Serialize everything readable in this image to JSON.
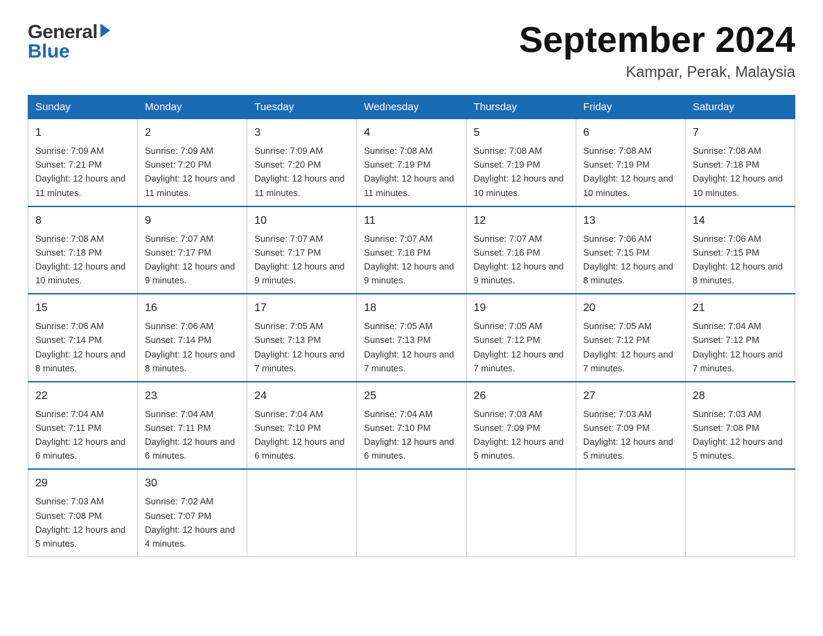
{
  "header": {
    "logo_general": "General",
    "logo_blue": "Blue",
    "month_title": "September 2024",
    "location": "Kampar, Perak, Malaysia"
  },
  "days_of_week": [
    "Sunday",
    "Monday",
    "Tuesday",
    "Wednesday",
    "Thursday",
    "Friday",
    "Saturday"
  ],
  "weeks": [
    [
      {
        "day": "1",
        "sunrise": "7:09 AM",
        "sunset": "7:21 PM",
        "daylight": "12 hours and 11 minutes."
      },
      {
        "day": "2",
        "sunrise": "7:09 AM",
        "sunset": "7:20 PM",
        "daylight": "12 hours and 11 minutes."
      },
      {
        "day": "3",
        "sunrise": "7:09 AM",
        "sunset": "7:20 PM",
        "daylight": "12 hours and 11 minutes."
      },
      {
        "day": "4",
        "sunrise": "7:08 AM",
        "sunset": "7:19 PM",
        "daylight": "12 hours and 11 minutes."
      },
      {
        "day": "5",
        "sunrise": "7:08 AM",
        "sunset": "7:19 PM",
        "daylight": "12 hours and 10 minutes."
      },
      {
        "day": "6",
        "sunrise": "7:08 AM",
        "sunset": "7:19 PM",
        "daylight": "12 hours and 10 minutes."
      },
      {
        "day": "7",
        "sunrise": "7:08 AM",
        "sunset": "7:18 PM",
        "daylight": "12 hours and 10 minutes."
      }
    ],
    [
      {
        "day": "8",
        "sunrise": "7:08 AM",
        "sunset": "7:18 PM",
        "daylight": "12 hours and 10 minutes."
      },
      {
        "day": "9",
        "sunrise": "7:07 AM",
        "sunset": "7:17 PM",
        "daylight": "12 hours and 9 minutes."
      },
      {
        "day": "10",
        "sunrise": "7:07 AM",
        "sunset": "7:17 PM",
        "daylight": "12 hours and 9 minutes."
      },
      {
        "day": "11",
        "sunrise": "7:07 AM",
        "sunset": "7:16 PM",
        "daylight": "12 hours and 9 minutes."
      },
      {
        "day": "12",
        "sunrise": "7:07 AM",
        "sunset": "7:16 PM",
        "daylight": "12 hours and 9 minutes."
      },
      {
        "day": "13",
        "sunrise": "7:06 AM",
        "sunset": "7:15 PM",
        "daylight": "12 hours and 8 minutes."
      },
      {
        "day": "14",
        "sunrise": "7:06 AM",
        "sunset": "7:15 PM",
        "daylight": "12 hours and 8 minutes."
      }
    ],
    [
      {
        "day": "15",
        "sunrise": "7:06 AM",
        "sunset": "7:14 PM",
        "daylight": "12 hours and 8 minutes."
      },
      {
        "day": "16",
        "sunrise": "7:06 AM",
        "sunset": "7:14 PM",
        "daylight": "12 hours and 8 minutes."
      },
      {
        "day": "17",
        "sunrise": "7:05 AM",
        "sunset": "7:13 PM",
        "daylight": "12 hours and 7 minutes."
      },
      {
        "day": "18",
        "sunrise": "7:05 AM",
        "sunset": "7:13 PM",
        "daylight": "12 hours and 7 minutes."
      },
      {
        "day": "19",
        "sunrise": "7:05 AM",
        "sunset": "7:12 PM",
        "daylight": "12 hours and 7 minutes."
      },
      {
        "day": "20",
        "sunrise": "7:05 AM",
        "sunset": "7:12 PM",
        "daylight": "12 hours and 7 minutes."
      },
      {
        "day": "21",
        "sunrise": "7:04 AM",
        "sunset": "7:12 PM",
        "daylight": "12 hours and 7 minutes."
      }
    ],
    [
      {
        "day": "22",
        "sunrise": "7:04 AM",
        "sunset": "7:11 PM",
        "daylight": "12 hours and 6 minutes."
      },
      {
        "day": "23",
        "sunrise": "7:04 AM",
        "sunset": "7:11 PM",
        "daylight": "12 hours and 6 minutes."
      },
      {
        "day": "24",
        "sunrise": "7:04 AM",
        "sunset": "7:10 PM",
        "daylight": "12 hours and 6 minutes."
      },
      {
        "day": "25",
        "sunrise": "7:04 AM",
        "sunset": "7:10 PM",
        "daylight": "12 hours and 6 minutes."
      },
      {
        "day": "26",
        "sunrise": "7:03 AM",
        "sunset": "7:09 PM",
        "daylight": "12 hours and 5 minutes."
      },
      {
        "day": "27",
        "sunrise": "7:03 AM",
        "sunset": "7:09 PM",
        "daylight": "12 hours and 5 minutes."
      },
      {
        "day": "28",
        "sunrise": "7:03 AM",
        "sunset": "7:08 PM",
        "daylight": "12 hours and 5 minutes."
      }
    ],
    [
      {
        "day": "29",
        "sunrise": "7:03 AM",
        "sunset": "7:08 PM",
        "daylight": "12 hours and 5 minutes."
      },
      {
        "day": "30",
        "sunrise": "7:02 AM",
        "sunset": "7:07 PM",
        "daylight": "12 hours and 4 minutes."
      },
      null,
      null,
      null,
      null,
      null
    ]
  ]
}
